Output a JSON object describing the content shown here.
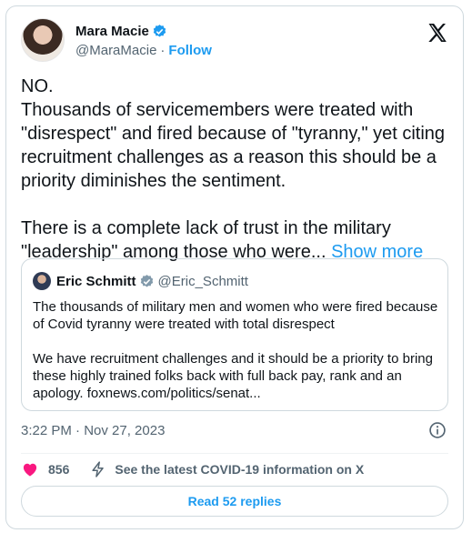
{
  "author": {
    "display_name": "Mara Macie",
    "handle": "@MaraMacie",
    "separator": "·",
    "follow_label": "Follow"
  },
  "tweet": {
    "text": "NO.\nThousands of servicemembers were treated with \"disrespect\" and fired because of \"tyranny,\" yet citing recruitment challenges as a reason this should be a priority diminishes the sentiment.\n\nThere is a complete lack of trust in the military \"leadership\" among those who were... ",
    "show_more_label": "Show more"
  },
  "quote": {
    "display_name": "Eric Schmitt",
    "handle": "@Eric_Schmitt",
    "text": "The thousands of military men and women who were fired because of Covid tyranny were treated with total disrespect\n\nWe have recruitment challenges and it should be a priority to bring these highly trained folks back with full back pay, rank and an apology. foxnews.com/politics/senat..."
  },
  "meta": {
    "timestamp": "3:22 PM · Nov 27, 2023"
  },
  "actions": {
    "like_count": "856",
    "covid_info_label": "See the latest COVID-19 information on X",
    "read_replies_label": "Read 52 replies"
  },
  "icons": {
    "verified": "verified-badge-icon",
    "logo": "x-logo-icon",
    "info": "info-icon",
    "heart": "heart-icon",
    "bolt": "lightning-icon"
  },
  "colors": {
    "accent": "#1d9bf0",
    "heart": "#f91880",
    "muted": "#536471"
  }
}
